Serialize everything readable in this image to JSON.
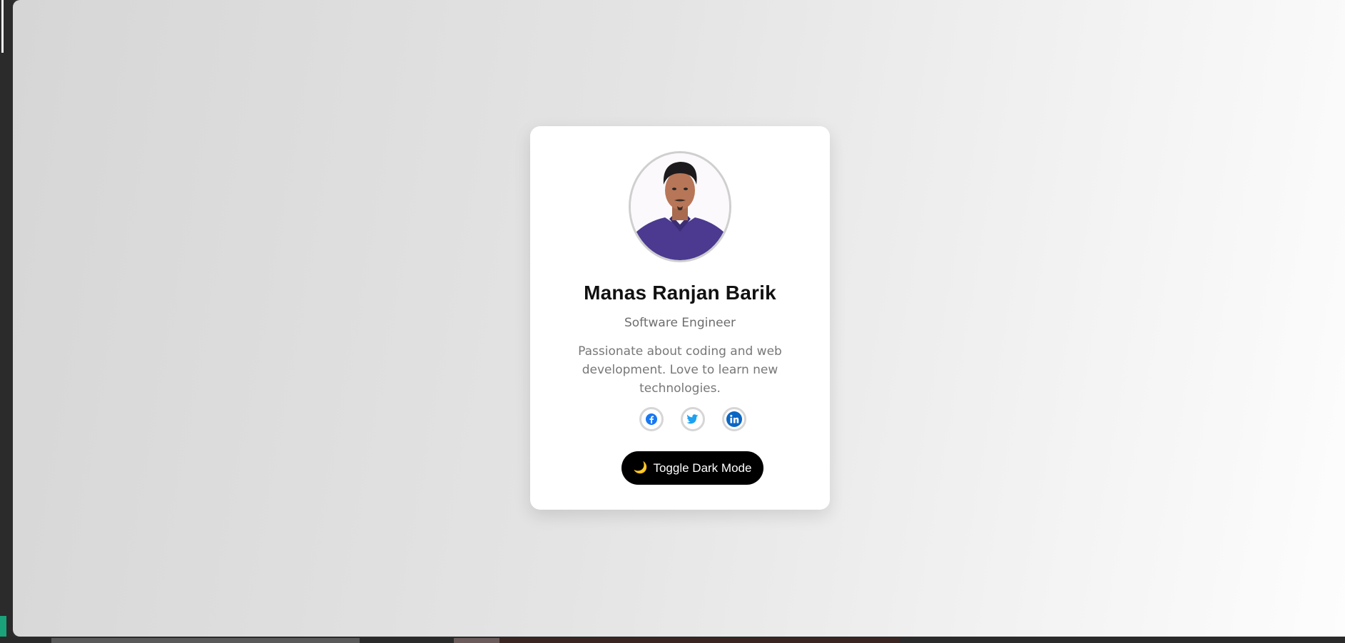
{
  "profile": {
    "name": "Manas Ranjan Barik",
    "role": "Software Engineer",
    "bio": "Passionate about coding and web development. Love to learn new technologies."
  },
  "socials": [
    {
      "name": "facebook",
      "icon": "facebook-icon",
      "color": "#1877f2"
    },
    {
      "name": "twitter",
      "icon": "twitter-icon",
      "color": "#1da1f2"
    },
    {
      "name": "linkedin",
      "icon": "linkedin-icon",
      "color": "#0a66c2"
    }
  ],
  "toggle": {
    "icon": "moon-icon",
    "label": "Toggle Dark Mode"
  },
  "colors": {
    "button_bg": "#000000",
    "card_bg": "#ffffff"
  }
}
